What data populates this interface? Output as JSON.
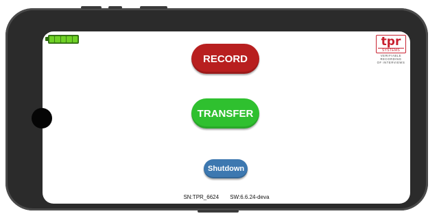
{
  "buttons": {
    "record": "RECORD",
    "transfer": "TRANSFER",
    "shutdown": "Shutdown"
  },
  "battery": {
    "level": 1.0,
    "color": "#6fd126"
  },
  "logo": {
    "brand": "tpr",
    "subbrand": "SYSTEMS",
    "tagline": [
      "VERIFIABLE",
      "RECORDING",
      "OF INTERVIEWS"
    ]
  },
  "footer": {
    "serial": "SN:TPR_6624",
    "software": "SW:6.6.24-deva"
  },
  "colors": {
    "record": "#b81f1f",
    "transfer": "#2fc02f",
    "shutdown": "#3d78b0",
    "brand": "#c8202f"
  }
}
